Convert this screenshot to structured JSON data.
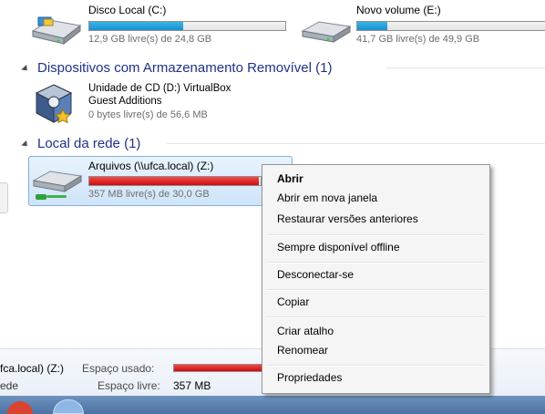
{
  "drives": {
    "c": {
      "name": "Disco Local (C:)",
      "free": "12,9 GB livre(s) de 24,8 GB",
      "used_fraction": 0.48
    },
    "e": {
      "name": "Novo volume (E:)",
      "free": "41,7 GB livre(s) de 49,9 GB",
      "used_fraction": 0.16
    }
  },
  "groups": {
    "removable": {
      "title": "Dispositivos com Armazenamento Removível (1)"
    },
    "network": {
      "title": "Local da rede (1)"
    }
  },
  "cd": {
    "name_line1": "Unidade de CD (D:) VirtualBox",
    "name_line2": "Guest Additions",
    "free": "0 bytes livre(s) de 56,6 MB"
  },
  "network_drive": {
    "name": "Arquivos (\\\\ufca.local) (Z:)",
    "free": "357 MB livre(s) de 30,0 GB",
    "used_fraction": 0.99
  },
  "context_menu": {
    "open": "Abrir",
    "open_new_window": "Abrir em nova janela",
    "restore_previous": "Restaurar versões anteriores",
    "always_offline": "Sempre disponível offline",
    "disconnect": "Desconectar-se",
    "copy": "Copiar",
    "create_shortcut": "Criar atalho",
    "rename": "Renomear",
    "properties": "Propriedades"
  },
  "details": {
    "drive_label": "fca.local) (Z:)",
    "used_label": "Espaço usado:",
    "type_label": "ede",
    "free_label": "Espaço livre:",
    "free_value": "357 MB"
  },
  "colors": {
    "accent_blue": "#1a8fd0",
    "full_red": "#cf0b0b",
    "group_header": "#1e3287"
  }
}
